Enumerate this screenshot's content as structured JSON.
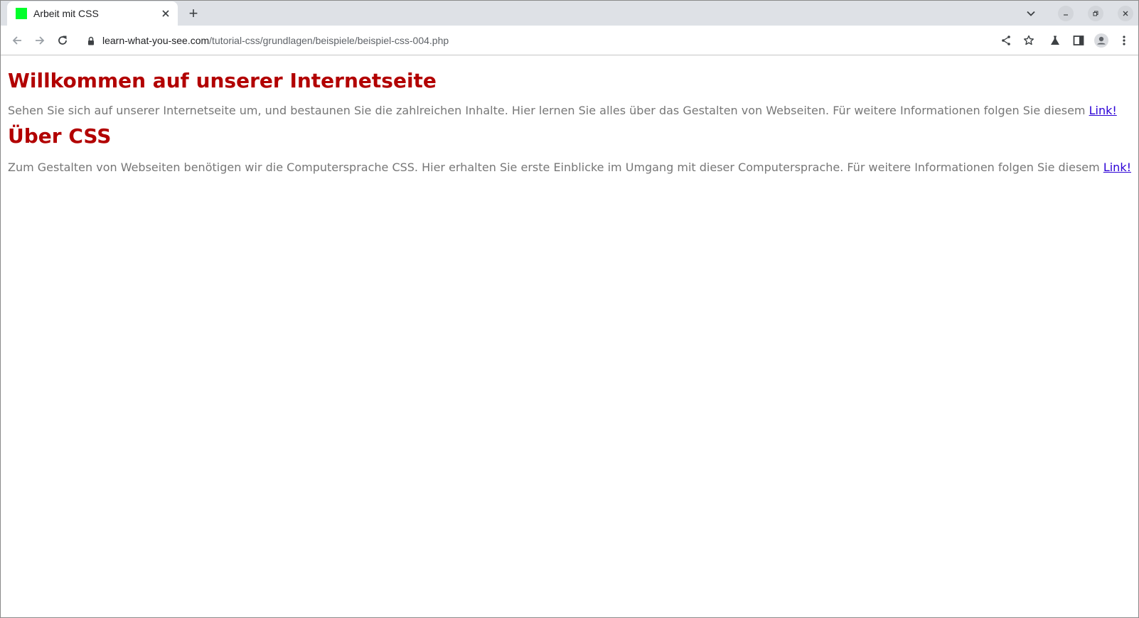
{
  "browser": {
    "tab": {
      "title": "Arbeit mit CSS",
      "favicon_color": "#00ff2a"
    },
    "new_tab_label": "+",
    "url": {
      "host": "learn-what-you-see.com",
      "path": "/tutorial-css/grundlagen/beispiele/beispiel-css-004.php"
    },
    "window_buttons": [
      "minimize-icon",
      "restore-icon",
      "close-icon"
    ],
    "toolbar_icons": [
      "share-icon",
      "bookmark-star-icon",
      "labs-flask-icon",
      "side-panel-icon",
      "profile-avatar-icon",
      "more-menu-icon"
    ]
  },
  "page": {
    "heading1": "Willkommen auf unserer Internetseite",
    "paragraph1": {
      "text": "Sehen Sie sich auf unserer Internetseite um, und bestaunen Sie die zahlreichen Inhalte. Hier lernen Sie alles über das Gestalten von Webseiten. Für weitere Informationen folgen Sie diesem ",
      "link": "Link!"
    },
    "heading2": "Über CSS",
    "paragraph2": {
      "text": "Zum Gestalten von Webseiten benötigen wir die Computersprache CSS. Hier erhalten Sie erste Einblicke im Umgang mit dieser Computersprache. Für weitere Informationen folgen Sie diesem ",
      "link": "Link!"
    }
  },
  "colors": {
    "heading": "#b20000",
    "body_text": "#777777",
    "link": "#2b00d6"
  }
}
